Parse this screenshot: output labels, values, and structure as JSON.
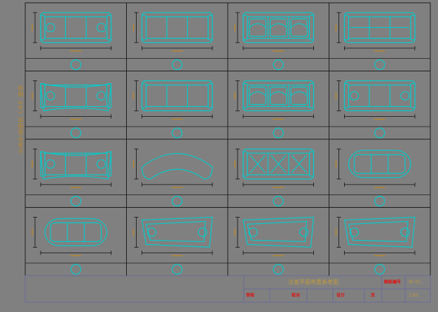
{
  "sheet": {
    "side_text": "沙发平面图库 CAD 图块",
    "title_block": {
      "title": "沙发平面布置参考图",
      "drawing_no_label": "图纸编号",
      "drawing_no_value": "SF-01",
      "scale_value": "1:50",
      "label_1": "审核",
      "label_2": "校对",
      "label_3": "设计",
      "label_4": "页"
    }
  },
  "colors": {
    "background": "#808080",
    "grid_line": "#1e1e1e",
    "symbol_line": "#0ac8c8",
    "dimension_line": "#101010",
    "dimension_text": "#b8862a",
    "red_text": "#e01010"
  },
  "grid": {
    "rows": 4,
    "cols": 4,
    "cells": [
      {
        "symbol": "three-seat-sofa-with-pillows-icon"
      },
      {
        "symbol": "three-seat-straight-sofa-icon"
      },
      {
        "symbol": "three-seat-patterned-sofa-icon"
      },
      {
        "symbol": "straight-sofa-thin-back-icon"
      },
      {
        "symbol": "curved-sofa-with-pillows-icon"
      },
      {
        "symbol": "three-seat-sofa-icon"
      },
      {
        "symbol": "sofa-with-patterned-cushions-icon"
      },
      {
        "symbol": "sofa-with-throw-icon"
      },
      {
        "symbol": "long-curved-sofa-icon"
      },
      {
        "symbol": "crescent-sofa-icon"
      },
      {
        "symbol": "sofa-with-x-cushions-icon"
      },
      {
        "symbol": "rounded-sofa-icon"
      },
      {
        "symbol": "small-loveseat-icon"
      },
      {
        "symbol": "chaise-sofa-icon"
      },
      {
        "symbol": "angled-sofa-icon"
      },
      {
        "symbol": "sofa-with-blanket-icon"
      }
    ]
  }
}
